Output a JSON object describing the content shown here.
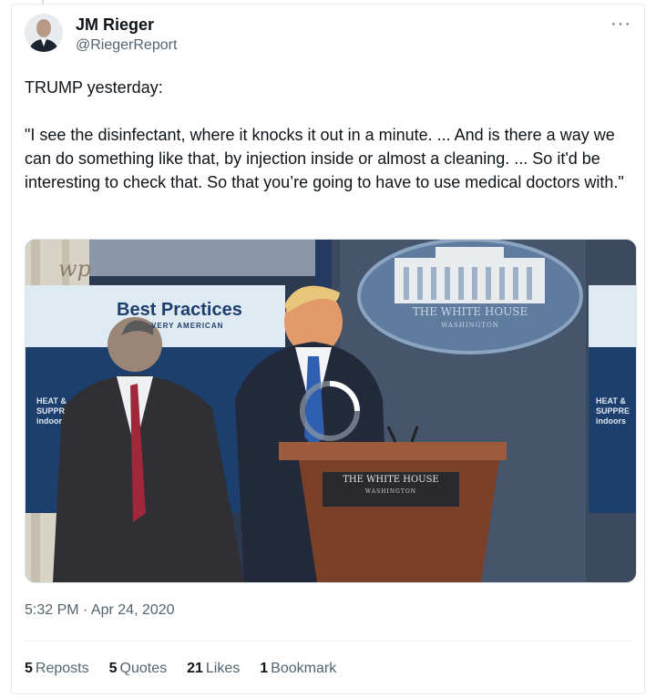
{
  "author": {
    "name": "JM Rieger",
    "handle": "@RiegerReport"
  },
  "more_menu": "···",
  "tweet": {
    "text": "TRUMP yesterday:\n\n\"I see the disinfectant, where it knocks it out in a minute. ... And is there a way we can do something like that, by injection inside or almost a cleaning. ... So it'd be interesting to check that. So that you’re going to have to use medical doctors with.\""
  },
  "media": {
    "banner_title": "Best Practices",
    "banner_subtitle": "VERY AMERICAN",
    "left_screen_text": [
      "HEAT &",
      "SUPPR",
      "indoor"
    ],
    "right_screen_text": [
      "HEAT &",
      "SUPPRE",
      "indoors"
    ],
    "seal_top": "THE WHITE HOUSE",
    "seal_bottom": "WASHINGTON",
    "podium_top": "THE WHITE HOUSE",
    "podium_bottom": "WASHINGTON",
    "logo": "wp"
  },
  "timestamp": "5:32 PM · Apr 24, 2020",
  "stats": [
    {
      "count": "5",
      "label": "Reposts"
    },
    {
      "count": "5",
      "label": "Quotes"
    },
    {
      "count": "21",
      "label": "Likes"
    },
    {
      "count": "1",
      "label": "Bookmark"
    }
  ],
  "colors": {
    "text": "#0f1419",
    "secondary": "#536471",
    "border": "#e6e9ec"
  }
}
